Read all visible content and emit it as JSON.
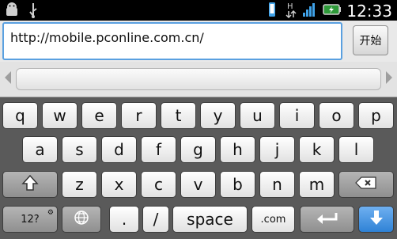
{
  "status_bar": {
    "clock": "12:33",
    "left_icons": [
      "android-icon",
      "usb-icon"
    ],
    "right_icons": [
      "vibrate-icon",
      "data-h-icon",
      "signal-icon",
      "battery-icon"
    ]
  },
  "browser": {
    "url_value": "http://mobile.pconline.com.cn/",
    "go_label": "开始"
  },
  "keyboard": {
    "row1": [
      "q",
      "w",
      "e",
      "r",
      "t",
      "y",
      "u",
      "i",
      "o",
      "p"
    ],
    "row2": [
      "a",
      "s",
      "d",
      "f",
      "g",
      "h",
      "j",
      "k",
      "l"
    ],
    "row3": [
      "z",
      "x",
      "c",
      "v",
      "b",
      "n",
      "m"
    ],
    "row4": {
      "symbols_label": "12?",
      "period_label": ".",
      "slash_label": "/",
      "space_label": "space",
      "dotcom_label": ".com"
    }
  },
  "colors": {
    "focus_border": "#5aa0e0",
    "blue_key": "#2f82d6",
    "keyboard_bg": "#5a5a5a"
  }
}
